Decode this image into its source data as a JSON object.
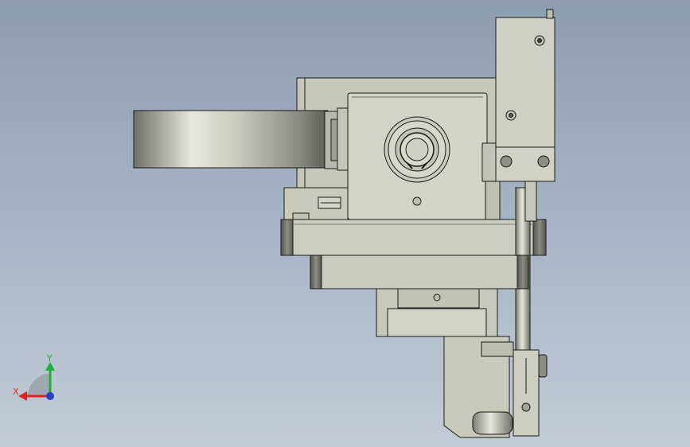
{
  "triad": {
    "x_label": "X",
    "y_label": "Y",
    "x_color": "#e0252a",
    "y_color": "#19b33a",
    "z_color": "#2a3cc9"
  },
  "colors": {
    "part_fill": "#c9cabc",
    "part_fill_light": "#d6d7cb",
    "part_edge": "#1a1a1a",
    "dark_face": "#5f6058",
    "background_top": "#8d9db0",
    "background_bottom": "#c3ccd6"
  }
}
